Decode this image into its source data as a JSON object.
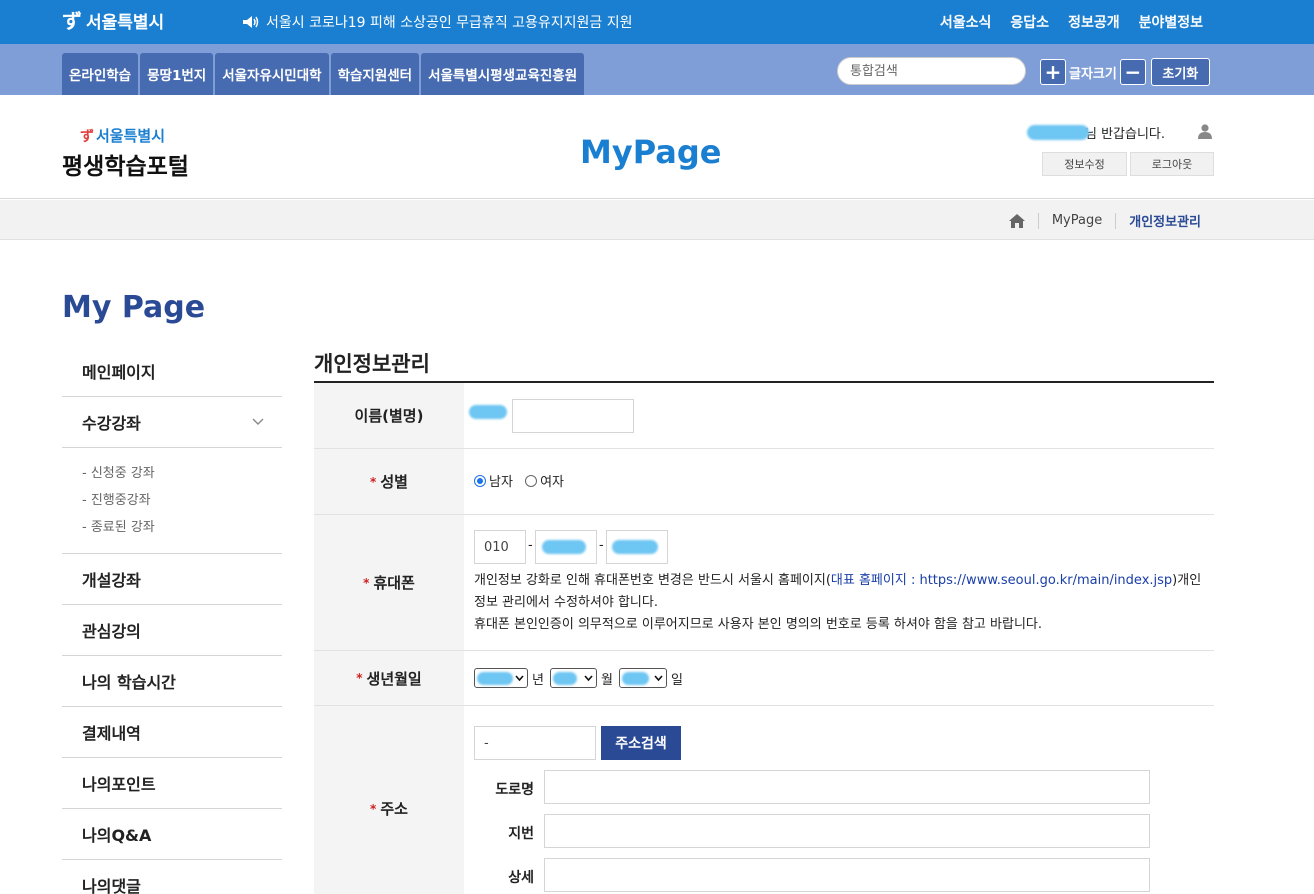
{
  "topbar": {
    "logo": "서울특별시",
    "notice": "서울시 코로나19 피해 소상공인 무급휴직 고용유지지원금 지원",
    "nav": [
      "서울소식",
      "응답소",
      "정보공개",
      "분야별정보"
    ]
  },
  "subbar": {
    "tabs": [
      "온라인학습",
      "몽땅1번지",
      "서울자유시민대학",
      "학습지원센터",
      "서울특별시평생교육진흥원"
    ],
    "search_placeholder": "통합검색",
    "font_size_label": "글자크기",
    "reset_label": "초기화"
  },
  "header": {
    "brand_sub": "서울특별시",
    "brand_main": "평생학습포털",
    "page_title": "MyPage",
    "greeting": "님 반갑습니다.",
    "edit_info": "정보수정",
    "logout": "로그아웃"
  },
  "breadcrumb": {
    "items": [
      "MyPage",
      "개인정보관리"
    ]
  },
  "sidebar": {
    "title": "My Page",
    "items": [
      {
        "label": "메인페이지"
      },
      {
        "label": "수강강좌",
        "subs": [
          "- 신청중 강좌",
          "- 진행중강좌",
          "- 종료된 강좌"
        ]
      },
      {
        "label": "개설강좌"
      },
      {
        "label": "관심강의"
      },
      {
        "label": "나의 학습시간"
      },
      {
        "label": "결제내역"
      },
      {
        "label": "나의포인트"
      },
      {
        "label": "나의Q&A"
      },
      {
        "label": "나의댓글"
      }
    ]
  },
  "content": {
    "title": "개인정보관리",
    "rows": {
      "name": {
        "label": "이름(별명)"
      },
      "gender": {
        "label": "성별",
        "male": "남자",
        "female": "여자",
        "selected": "남자"
      },
      "phone": {
        "label": "휴대폰",
        "prefix": "010",
        "dash": "-",
        "note1a": "개인정보 강화로 인해 휴대폰번호 변경은 반드시 서울시 홈페이지(",
        "note1link": "대표 홈페이지 : https://www.seoul.go.kr/main/index.jsp",
        "note1b": ")개인정보 관리에서 수정하셔야 합니다.",
        "note2": "휴대폰 본인인증이 의무적으로 이루어지므로 사용자 본인 명의의 번호로 등록 하셔야 함을 참고 바랍니다."
      },
      "birth": {
        "label": "생년월일",
        "year": "년",
        "month": "월",
        "day": "일"
      },
      "address": {
        "label": "주소",
        "zip": "-",
        "search_button": "주소검색",
        "road": "도로명",
        "lot": "지번",
        "detail": "상세"
      }
    },
    "required_mark": "*"
  },
  "colors": {
    "topbar": "#1a7fd1",
    "subbar": "#7f9ed7",
    "tab": "#476bb0",
    "accent_navy": "#2a4a95",
    "page_title": "#1a7fd1"
  }
}
